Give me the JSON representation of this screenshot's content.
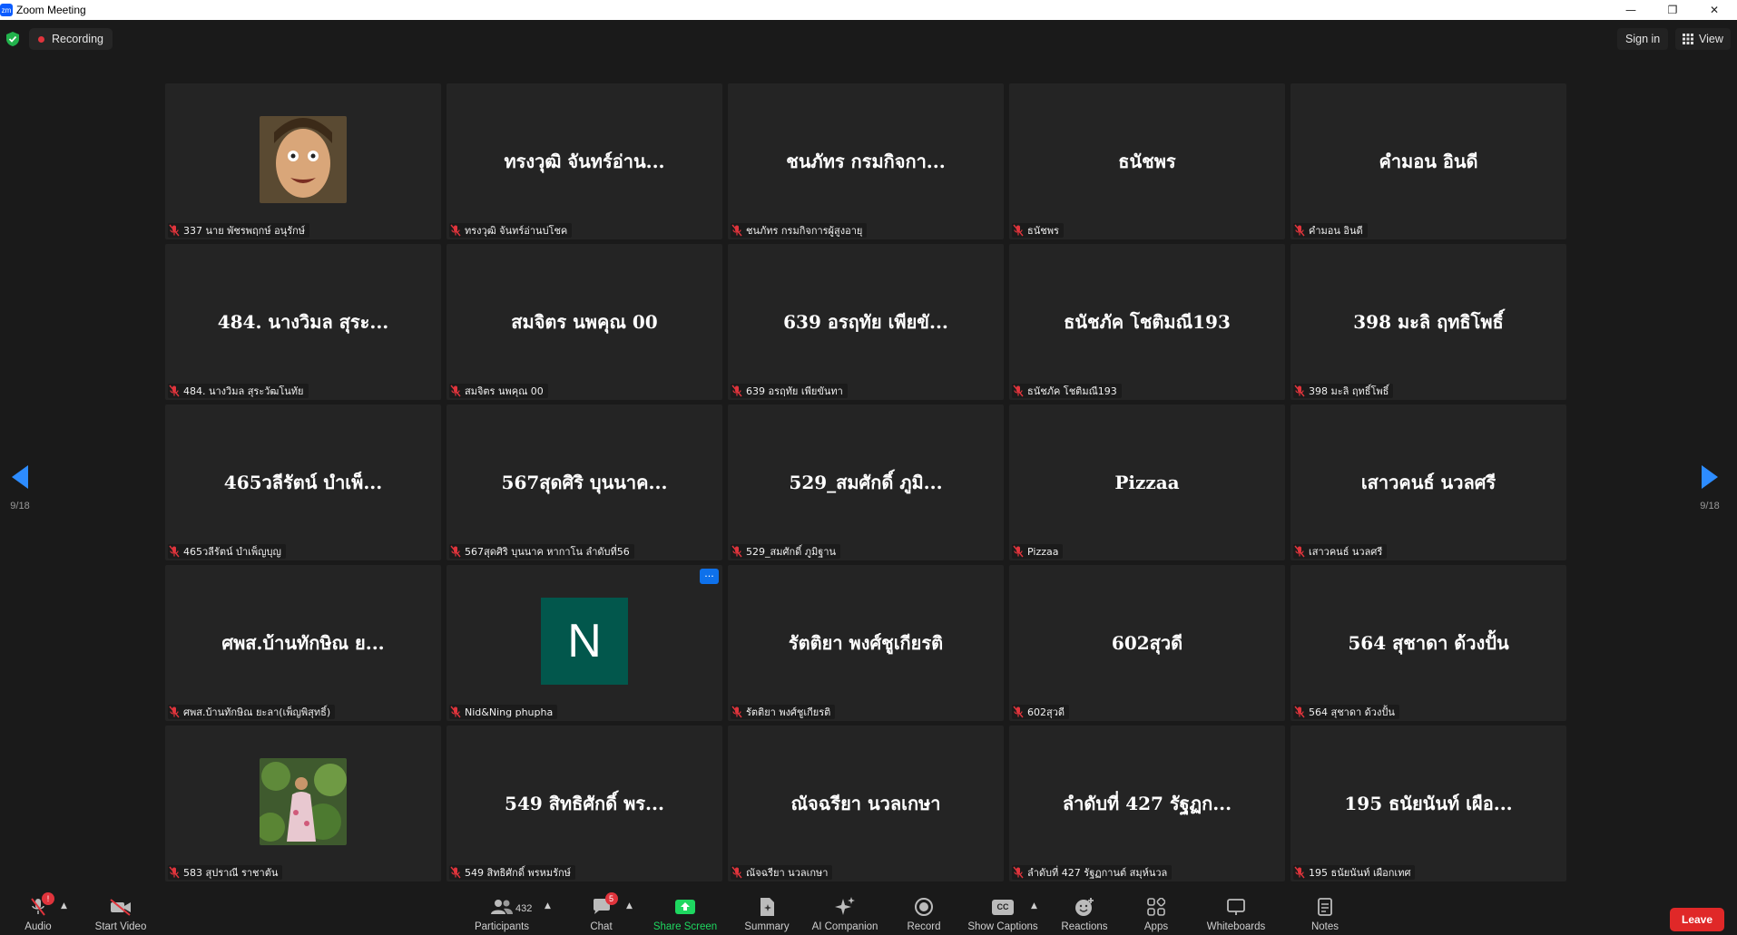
{
  "window": {
    "title": "Zoom Meeting",
    "logo_text": "zm"
  },
  "topbar": {
    "recording_label": "Recording",
    "signin_label": "Sign in",
    "view_label": "View"
  },
  "pager": {
    "left_page": "9/18",
    "right_page": "9/18"
  },
  "tiles": [
    {
      "big": "",
      "name": "337 นาย พัชรพฤกษ์ อนุรักษ์",
      "media": "photo1"
    },
    {
      "big": "ทรงวุฒิ จันทร์อ่าน...",
      "name": "ทรงวุฒิ จันทร์อ่านบ่โชค"
    },
    {
      "big": "ชนภัทร กรมกิจกา...",
      "name": "ชนภัทร กรมกิจการผู้สูงอายุ"
    },
    {
      "big": "ธนัชพร",
      "name": "ธนัชพร"
    },
    {
      "big": "คำมอน อินดี",
      "name": "คำมอน อินดี"
    },
    {
      "big": "484. นางวิมล สุระ...",
      "name": "484. นางวิมล สุระวัฒโนทัย"
    },
    {
      "big": "สมจิตร นพคุณ 00",
      "name": "สมจิตร นพคุณ 00"
    },
    {
      "big": "639 อรฤทัย เพียขั...",
      "name": "639 อรฤทัย เพียขันทา"
    },
    {
      "big": "ธนัชภัค โชติมณี193",
      "name": "ธนัชภัค โชติมณี193"
    },
    {
      "big": "398 มะลิ ฤทธิโพธิ์",
      "name": "398 มะลิ ฤทธิ์โพธิ์"
    },
    {
      "big": "465วลีรัตน์ บำเพ็...",
      "name": "465วลีรัตน์ บำเพ็ญบุญ"
    },
    {
      "big": "567สุดศิริ บุนนาค...",
      "name": "567สุดศิริ บุนนาค หากาโน ลำดับที่56"
    },
    {
      "big": "529_สมศักดิ์  ภูมิ...",
      "name": "529_สมศักดิ์  ภูมิฐาน"
    },
    {
      "big": "Pizzaa",
      "name": "Pizzaa"
    },
    {
      "big": "เสาวคนธ์ นวลศรี",
      "name": "เสาวคนธ์ นวลศรี"
    },
    {
      "big": "ศพส.บ้านทักษิณ ย...",
      "name": "ศพส.บ้านทักษิณ ยะลา(เพ็ญพิสุทธิ์)"
    },
    {
      "big": "",
      "name": "Nid&Ning phupha",
      "media": "avatar",
      "avatar_letter": "N",
      "more": "···"
    },
    {
      "big": "รัตติยา พงศ์ชูเกียรติ",
      "name": "รัตติยา พงศ์ชูเกียรติ"
    },
    {
      "big": "602สุวดี",
      "name": "602สุวดี"
    },
    {
      "big": "564 สุชาดา ด้วงปั้น",
      "name": "564 สุชาดา ด้วงปั้น"
    },
    {
      "big": "",
      "name": "583 สุปราณี ราชาตัน",
      "media": "photo2"
    },
    {
      "big": "549 สิทธิศักดิ์ พร...",
      "name": "549 สิทธิศักดิ์ พรหมรักษ์"
    },
    {
      "big": "ณัจฉรียา นวลเกษา",
      "name": "ณัจฉรียา นวลเกษา"
    },
    {
      "big": "ลำดับที่ 427 รัฐฏก...",
      "name": "ลำดับที่ 427 รัฐฏกานต์ สมุห์นวล"
    },
    {
      "big": "195 ธนัยนันท์ เผือ...",
      "name": "195 ธนัยนันท์ เผือกเทศ"
    }
  ],
  "toolbar": {
    "audio": {
      "label": "Audio",
      "badge": "!"
    },
    "start_video": {
      "label": "Start Video"
    },
    "participants": {
      "label": "Participants",
      "count": "432"
    },
    "chat": {
      "label": "Chat",
      "badge": "5"
    },
    "share_screen": {
      "label": "Share Screen"
    },
    "summary": {
      "label": "Summary"
    },
    "ai_companion": {
      "label": "AI Companion"
    },
    "record": {
      "label": "Record"
    },
    "show_captions": {
      "label": "Show Captions",
      "icon_text": "CC"
    },
    "reactions": {
      "label": "Reactions"
    },
    "apps": {
      "label": "Apps"
    },
    "whiteboards": {
      "label": "Whiteboards"
    },
    "notes": {
      "label": "Notes"
    },
    "leave": {
      "label": "Leave"
    }
  },
  "colors": {
    "accent_blue": "#0e71eb",
    "share_green": "#1ed760",
    "leave_red": "#e02828",
    "muted_red": "#e0343c"
  }
}
